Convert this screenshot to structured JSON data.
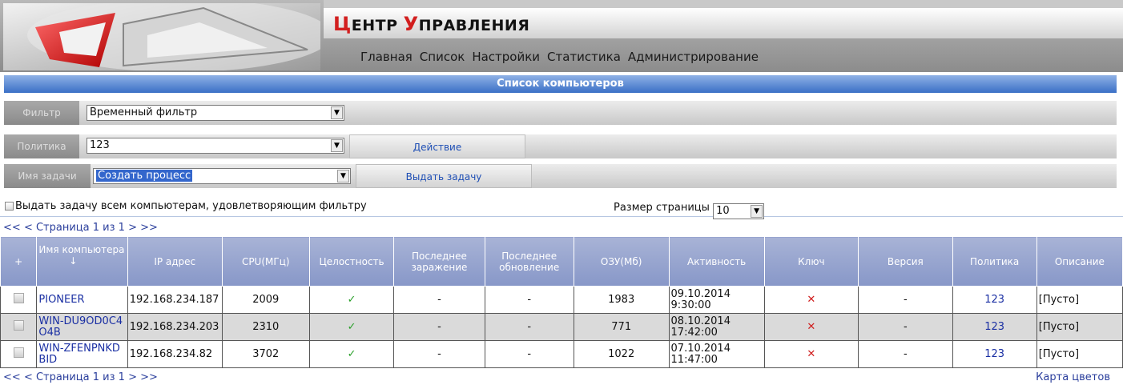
{
  "header": {
    "title_first_cap": "Ц",
    "title_rest_1": "ЕНТР ",
    "title_second_cap": "У",
    "title_rest_2": "ПРАВЛЕНИЯ",
    "nav": [
      "Главная",
      "Список",
      "Настройки",
      "Статистика",
      "Администрирование"
    ]
  },
  "section_title": "Список компьютеров",
  "filter": {
    "label": "Фильтр",
    "value": "Временный фильтр"
  },
  "policy": {
    "label": "Политика",
    "value": "123",
    "action_button": "Действие"
  },
  "task": {
    "label": "Имя задачи",
    "value": "Создать процесс",
    "assign_button": "Выдать задачу"
  },
  "assign_all_label": "Выдать задачу всем компьютерам, удовлетворяющим фильтру",
  "page_size": {
    "label": "Размер страницы",
    "value": "10"
  },
  "pager": {
    "first": "<<",
    "prev": "<",
    "text": "Страница 1 из 1",
    "next": ">",
    "last": ">>"
  },
  "color_map_link": "Карта цветов",
  "table": {
    "add_symbol": "+",
    "sort_arrow": "↓",
    "columns": [
      "Имя компьютера",
      "IP адрес",
      "CPU(МГц)",
      "Целостность",
      "Последнее заражение",
      "Последнее обновление",
      "ОЗУ(Мб)",
      "Активность",
      "Ключ",
      "Версия",
      "Политика",
      "Описание"
    ],
    "rows": [
      {
        "name": "PIONEER",
        "ip": "192.168.234.187",
        "cpu": "2009",
        "integrity": "✓",
        "last_infection": "-",
        "last_update": "-",
        "ram": "1983",
        "activity_date": "09.10.2014",
        "activity_time": "9:30:00",
        "key": "✕",
        "version": "-",
        "policy": "123",
        "description": "[Пусто]"
      },
      {
        "name": "WIN-DU9OD0C4O4B",
        "ip": "192.168.234.203",
        "cpu": "2310",
        "integrity": "✓",
        "last_infection": "-",
        "last_update": "-",
        "ram": "771",
        "activity_date": "08.10.2014",
        "activity_time": "17:42:00",
        "key": "✕",
        "version": "-",
        "policy": "123",
        "description": "[Пусто]"
      },
      {
        "name": "WIN-ZFENPNKDBID",
        "ip": "192.168.234.82",
        "cpu": "3702",
        "integrity": "✓",
        "last_infection": "-",
        "last_update": "-",
        "ram": "1022",
        "activity_date": "07.10.2014",
        "activity_time": "11:47:00",
        "key": "✕",
        "version": "-",
        "policy": "123",
        "description": "[Пусто]"
      }
    ]
  },
  "colors": {
    "accent_red": "#d21f1f",
    "header_blue": "#3a6fc6",
    "link_blue": "#1a2fa3"
  }
}
